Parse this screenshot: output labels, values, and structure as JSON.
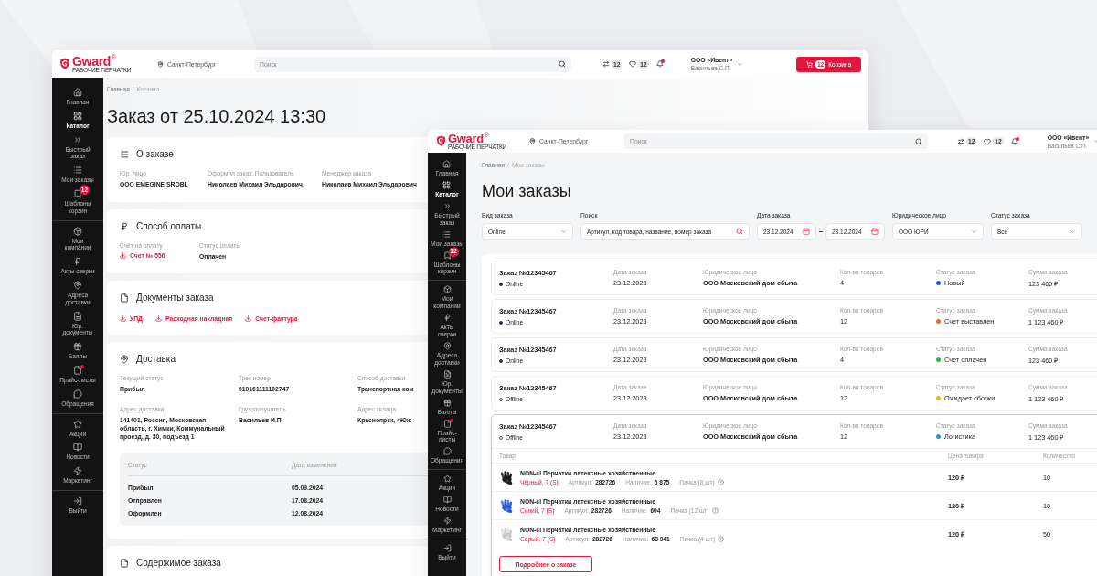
{
  "back_window": {
    "header": {
      "logo": {
        "name": "Gward",
        "mark": "®",
        "tagline": "РАБОЧИЕ ПЕРЧАТКИ"
      },
      "city": "Санкт-Петербург",
      "search": {
        "placeholder": "Поиск"
      },
      "compare_count": "12",
      "favorites_count": "12",
      "notifications_unread": true,
      "company": "ООО «Ивент»",
      "user": "Васильев С.П.",
      "cart": {
        "count": "12",
        "label": "Корзина"
      }
    },
    "sidebar": {
      "sections": [
        {
          "items": [
            {
              "label": "Главная",
              "selected": false,
              "alert": false
            },
            {
              "label": "Каталог",
              "selected": true,
              "alert": false
            },
            {
              "label": "Быстрый заказ",
              "selected": false,
              "alert": false
            },
            {
              "label": "Мои заказы",
              "selected": false,
              "alert": false
            },
            {
              "label": "Шаблоны корзин",
              "selected": false,
              "alert": false,
              "badge": "12"
            }
          ]
        },
        {
          "items": [
            {
              "label": "Мои компании",
              "selected": false,
              "alert": false
            },
            {
              "label": "Акты сверки",
              "selected": false,
              "alert": false
            },
            {
              "label": "Адреса доставки",
              "selected": false,
              "alert": false
            },
            {
              "label": "Юр. документы",
              "selected": false,
              "alert": false
            },
            {
              "label": "Баллы",
              "selected": false,
              "alert": false
            },
            {
              "label": "Прайс-листы",
              "selected": false,
              "alert": true
            },
            {
              "label": "Обращения",
              "selected": false,
              "alert": false
            }
          ]
        },
        {
          "items": [
            {
              "label": "Акции",
              "selected": false,
              "alert": false
            },
            {
              "label": "Новости",
              "selected": false,
              "alert": false
            },
            {
              "label": "Маркетинг",
              "selected": false,
              "alert": false
            }
          ]
        },
        {
          "items": [
            {
              "label": "Выйти",
              "selected": false,
              "alert": false
            }
          ]
        }
      ]
    },
    "breadcrumbs": {
      "separator": "/",
      "items": [
        "Главная",
        "Корзина"
      ]
    },
    "title": "Заказ от 25.10.2024 13:30",
    "sections": [
      {
        "kind": "about",
        "title": "О заказе",
        "fields": [
          {
            "label": "Юр. лицо",
            "value": "ООО EMEGINE SROBL",
            "link": false
          },
          {
            "label": "Оформил заказ: Пользователь",
            "value": "Николаев Михаил Эльдарович",
            "link": false
          },
          {
            "label": "Менеджер заказа",
            "value": "Николаев Михаил Эльдарович",
            "link": false
          }
        ]
      },
      {
        "kind": "payment",
        "title": "Способ оплаты",
        "fields": [
          {
            "label": "Счёт на оплату",
            "value": "Счет № 556",
            "link": true
          },
          {
            "label": "Статус оплаты",
            "value": "Оплачен",
            "link": false
          }
        ]
      },
      {
        "kind": "documents",
        "title": "Документы заказа",
        "links": [
          "УПД",
          "Расходная накладная",
          "Счет-фактура"
        ]
      },
      {
        "kind": "delivery",
        "title": "Доставка",
        "fields": [
          {
            "label": "Текущий статус",
            "value": "Прибыл",
            "link": false
          },
          {
            "label": "Трек номер",
            "value": "010161111102747",
            "link": false
          },
          {
            "label": "Способ доставки",
            "value": "Транспортная ком",
            "link": false
          },
          {
            "label": "Адрес доставки",
            "value": "141401, Россия, Московская область, г. Химки, Коммунальный проезд, д. 30, подъезд 1",
            "link": false
          },
          {
            "label": "Грузополучатель",
            "value": "Васильев И.П.",
            "link": false
          },
          {
            "label": "Адрес склада",
            "value": "Красноярск, «Юж",
            "link": false
          }
        ],
        "history": {
          "columns": [
            "Статус",
            "Дата изменения"
          ],
          "rows": [
            [
              "Прибыл",
              "05.09.2024"
            ],
            [
              "Отправлен",
              "17.08.2024"
            ],
            [
              "Оформлен",
              "12.08.2024"
            ]
          ]
        }
      },
      {
        "kind": "contents",
        "title": "Содержимое заказа"
      }
    ]
  },
  "front_window": {
    "header": {
      "logo": {
        "name": "Gward",
        "mark": "®",
        "tagline": "РАБОЧИЕ ПЕРЧАТКИ"
      },
      "city": "Санкт-Петербург",
      "search": {
        "placeholder": "Поиск"
      },
      "compare_count": "12",
      "favorites_count": "12",
      "notifications_unread": true,
      "company": "ООО «Ивент»",
      "user": "Васильев С.П."
    },
    "sidebar": {
      "sections": [
        {
          "items": [
            {
              "label": "Главная",
              "selected": false,
              "alert": false
            },
            {
              "label": "Каталог",
              "selected": true,
              "alert": false
            },
            {
              "label": "Быстрый заказ",
              "selected": false,
              "alert": false
            },
            {
              "label": "Мои заказы",
              "selected": false,
              "alert": false
            },
            {
              "label": "Шаблоны корзин",
              "selected": false,
              "alert": false,
              "badge": "12"
            }
          ]
        },
        {
          "items": [
            {
              "label": "Мои компании",
              "selected": false,
              "alert": false
            },
            {
              "label": "Акты сверки",
              "selected": false,
              "alert": false
            },
            {
              "label": "Адреса доставки",
              "selected": false,
              "alert": false
            },
            {
              "label": "Юр. документы",
              "selected": false,
              "alert": false
            },
            {
              "label": "Баллы",
              "selected": false,
              "alert": false
            },
            {
              "label": "Прайс-листы",
              "selected": false,
              "alert": true
            },
            {
              "label": "Обращения",
              "selected": false,
              "alert": false
            }
          ]
        },
        {
          "items": [
            {
              "label": "Акции",
              "selected": false,
              "alert": false
            },
            {
              "label": "Новости",
              "selected": false,
              "alert": false
            },
            {
              "label": "Маркетинг",
              "selected": false,
              "alert": false
            }
          ]
        },
        {
          "items": [
            {
              "label": "Выйти",
              "selected": false,
              "alert": false
            }
          ]
        }
      ]
    },
    "breadcrumbs": {
      "separator": "/",
      "items": [
        "Главная",
        "Мои заказы"
      ]
    },
    "title": "Мои заказы",
    "filters": [
      {
        "kind": "select",
        "label": "Вид заказа",
        "value": "Online"
      },
      {
        "kind": "search",
        "label": "Поиск",
        "value": "Артикул, код товара, название, номер заказа"
      },
      {
        "kind": "date_range",
        "label": "Дата заказа",
        "from": "23.12.2024",
        "to": "23.12.2024"
      },
      {
        "kind": "select",
        "label": "Юридическое лицо",
        "value": "ООО ЮРИ"
      },
      {
        "kind": "select",
        "label": "Статус заказа",
        "value": "Все"
      }
    ],
    "orders": [
      {
        "labels": {
          "date": "Дата заказа",
          "entity": "Юридическое лицо",
          "count": "Кол-во товаров",
          "status": "Статус заказа",
          "sum": "Сумма заказа"
        },
        "number": "Заказ №12345467",
        "channel": "Online",
        "online": true,
        "date": "23.12.2023",
        "entity": "ООО Московский дом сбыта",
        "count": "4",
        "status": "Новый",
        "color": "#1f5ef5",
        "sum": "123 460 ₽",
        "expanded": false
      },
      {
        "labels": {
          "date": "Дата заказа",
          "entity": "Юридическое лицо",
          "count": "Кол-во товаров",
          "status": "Статус заказа",
          "sum": "Сумма заказа"
        },
        "number": "Заказ №12345467",
        "channel": "Online",
        "online": true,
        "date": "23.12.2023",
        "entity": "ООО Московский дом сбыта",
        "count": "12",
        "status": "Счет выставлен",
        "color": "#f26a1b",
        "sum": "1 123 460 ₽",
        "expanded": false
      },
      {
        "labels": {
          "date": "Дата заказа",
          "entity": "Юридическое лицо",
          "count": "Кол-во товаров",
          "status": "Статус заказа",
          "sum": "Сумма заказа"
        },
        "number": "Заказ №12345467",
        "channel": "Online",
        "online": true,
        "date": "23.12.2023",
        "entity": "ООО Московский дом сбыта",
        "count": "4",
        "status": "Счет оплачен",
        "color": "#22b83a",
        "sum": "123 460 ₽",
        "expanded": false
      },
      {
        "labels": {
          "date": "Дата заказа",
          "entity": "Юридическое лицо",
          "count": "Кол-во товаров",
          "status": "Статус заказа",
          "sum": "Сумма заказа"
        },
        "number": "Заказ №12345467",
        "channel": "Offline",
        "online": false,
        "date": "23.12.2023",
        "entity": "ООО Московский дом сбыта",
        "count": "12",
        "status": "Ожидает сборки",
        "color": "#f5b400",
        "sum": "1 123 460 ₽",
        "expanded": false
      },
      {
        "labels": {
          "date": "Дата заказа",
          "entity": "Юридическое лицо",
          "count": "Кол-во товаров",
          "status": "Статус заказа",
          "sum": "Сумма заказа"
        },
        "number": "Заказ №12345467",
        "channel": "Offline",
        "online": false,
        "date": "23.12.2023",
        "entity": "ООО Московский дом сбыта",
        "count": "12",
        "status": "Логистика",
        "color": "#15a3c8",
        "sum": "1 123 460 ₽",
        "expanded": true,
        "products": {
          "columns": [
            "Товар",
            "Цена товара",
            "Количество"
          ],
          "rows": [
            {
              "name": "NON-cl Перчатки латексные хозяйственные",
              "variant": "Чёрный, 7 (S)",
              "article_label": "Артикул:",
              "article": "282726",
              "stock_label": "Наличие:",
              "stock": "6 875",
              "pack": "Пачка (8 шт)",
              "price": "120 ₽",
              "quantity": "10"
            },
            {
              "name": "NON-cl Перчатки латексные хозяйственные",
              "variant": "Синий, 7 (S)",
              "article_label": "Артикул:",
              "article": "282726",
              "stock_label": "Наличие:",
              "stock": "604",
              "pack": "Пачка (12 шт)",
              "price": "120 ₽",
              "quantity": "10"
            },
            {
              "name": "NON-cl Перчатки латексные хозяйственные",
              "variant": "Серый, 7 (S)",
              "article_label": "Артикул:",
              "article": "282726",
              "stock_label": "Наличие:",
              "stock": "68 941",
              "pack": "Пачка (4 шт)",
              "price": "120 ₽",
              "quantity": "50"
            }
          ]
        },
        "details_button": "Подробнее о заказе"
      }
    ]
  }
}
